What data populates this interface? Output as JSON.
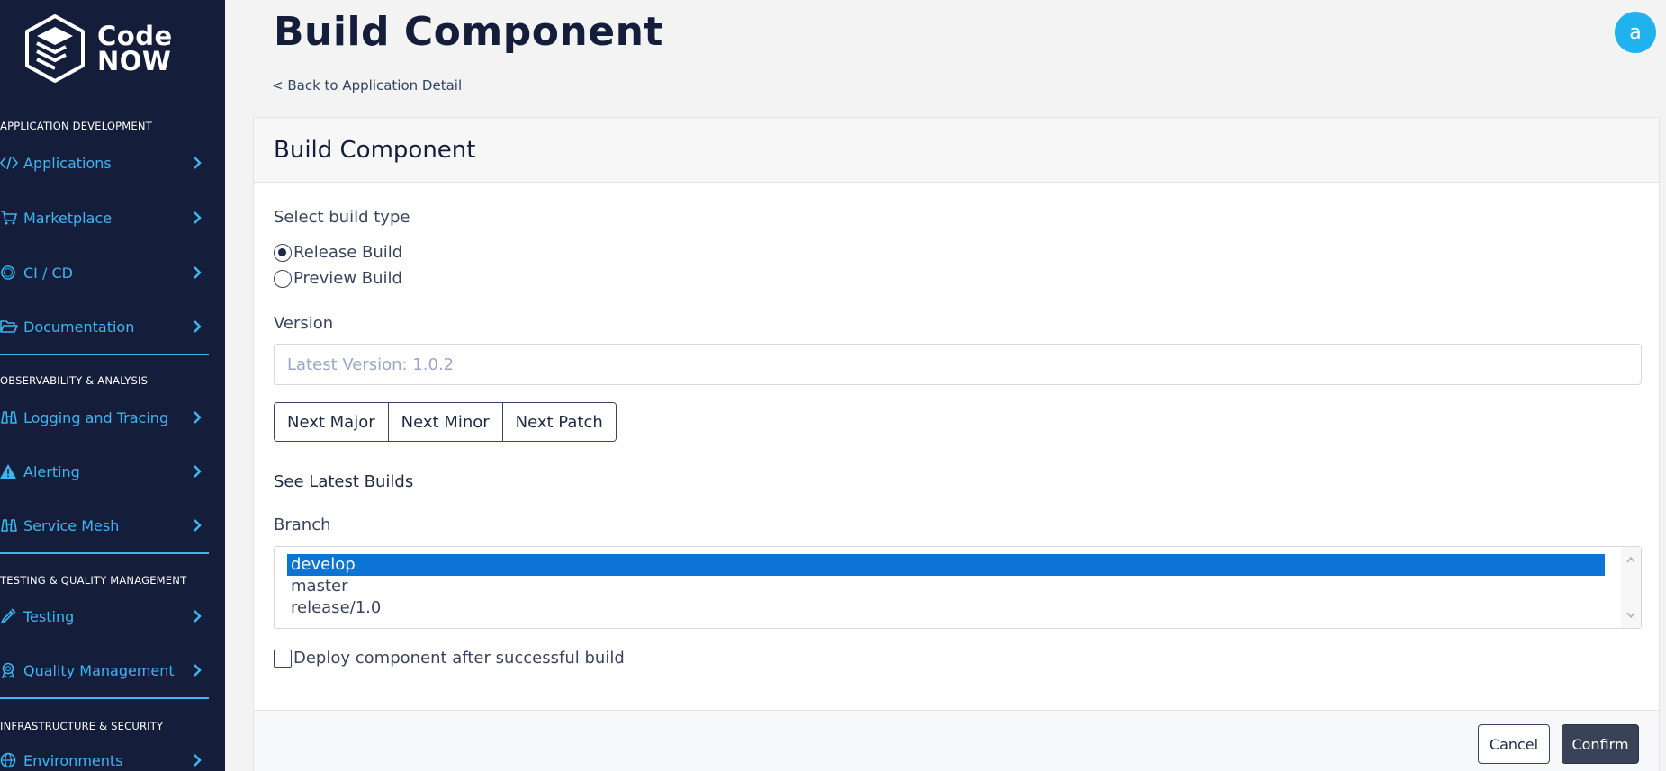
{
  "brand": {
    "line1": "Code",
    "line2": "NOW"
  },
  "sidebar": {
    "sections": [
      {
        "label": "APPLICATION DEVELOPMENT",
        "items": [
          {
            "label": "Applications",
            "icon": "code-icon"
          },
          {
            "label": "Marketplace",
            "icon": "cart-icon"
          },
          {
            "label": "CI / CD",
            "icon": "circle-icon"
          },
          {
            "label": "Documentation",
            "icon": "folder-open-icon"
          }
        ]
      },
      {
        "label": "OBSERVABILITY & ANALYSIS",
        "items": [
          {
            "label": "Logging and Tracing",
            "icon": "binoculars-icon"
          },
          {
            "label": "Alerting",
            "icon": "warning-icon"
          },
          {
            "label": "Service Mesh",
            "icon": "binoculars-icon"
          }
        ]
      },
      {
        "label": "TESTING & QUALITY MANAGEMENT",
        "items": [
          {
            "label": "Testing",
            "icon": "eyedropper-icon"
          },
          {
            "label": "Quality Management",
            "icon": "award-icon"
          }
        ]
      },
      {
        "label": "INFRASTRUCTURE & SECURITY",
        "items": [
          {
            "label": "Environments",
            "icon": "globe-icon"
          }
        ]
      }
    ]
  },
  "header": {
    "title": "Build Component",
    "back_link": "< Back to Application Detail",
    "avatar_initial": "a"
  },
  "card": {
    "title": "Build Component",
    "build_type_label": "Select build type",
    "build_types": [
      {
        "label": "Release Build",
        "selected": true
      },
      {
        "label": "Preview Build",
        "selected": false
      }
    ],
    "version_label": "Version",
    "version_value": "",
    "version_placeholder": "Latest Version: 1.0.2",
    "version_buttons": [
      "Next Major",
      "Next Minor",
      "Next Patch"
    ],
    "latest_builds_link": "See Latest Builds",
    "branch_label": "Branch",
    "branches": [
      {
        "label": "develop",
        "selected": true
      },
      {
        "label": "master",
        "selected": false
      },
      {
        "label": "release/1.0",
        "selected": false
      }
    ],
    "deploy_checkbox_label": "Deploy component after successful build",
    "deploy_checked": false,
    "cancel_label": "Cancel",
    "confirm_label": "Confirm"
  },
  "colors": {
    "sidebar_bg": "#141e3a",
    "accent": "#3fb4ef",
    "avatar_bg": "#1fb2ee",
    "selected_option": "#0b74d4",
    "confirm_bg": "#3a4257"
  }
}
